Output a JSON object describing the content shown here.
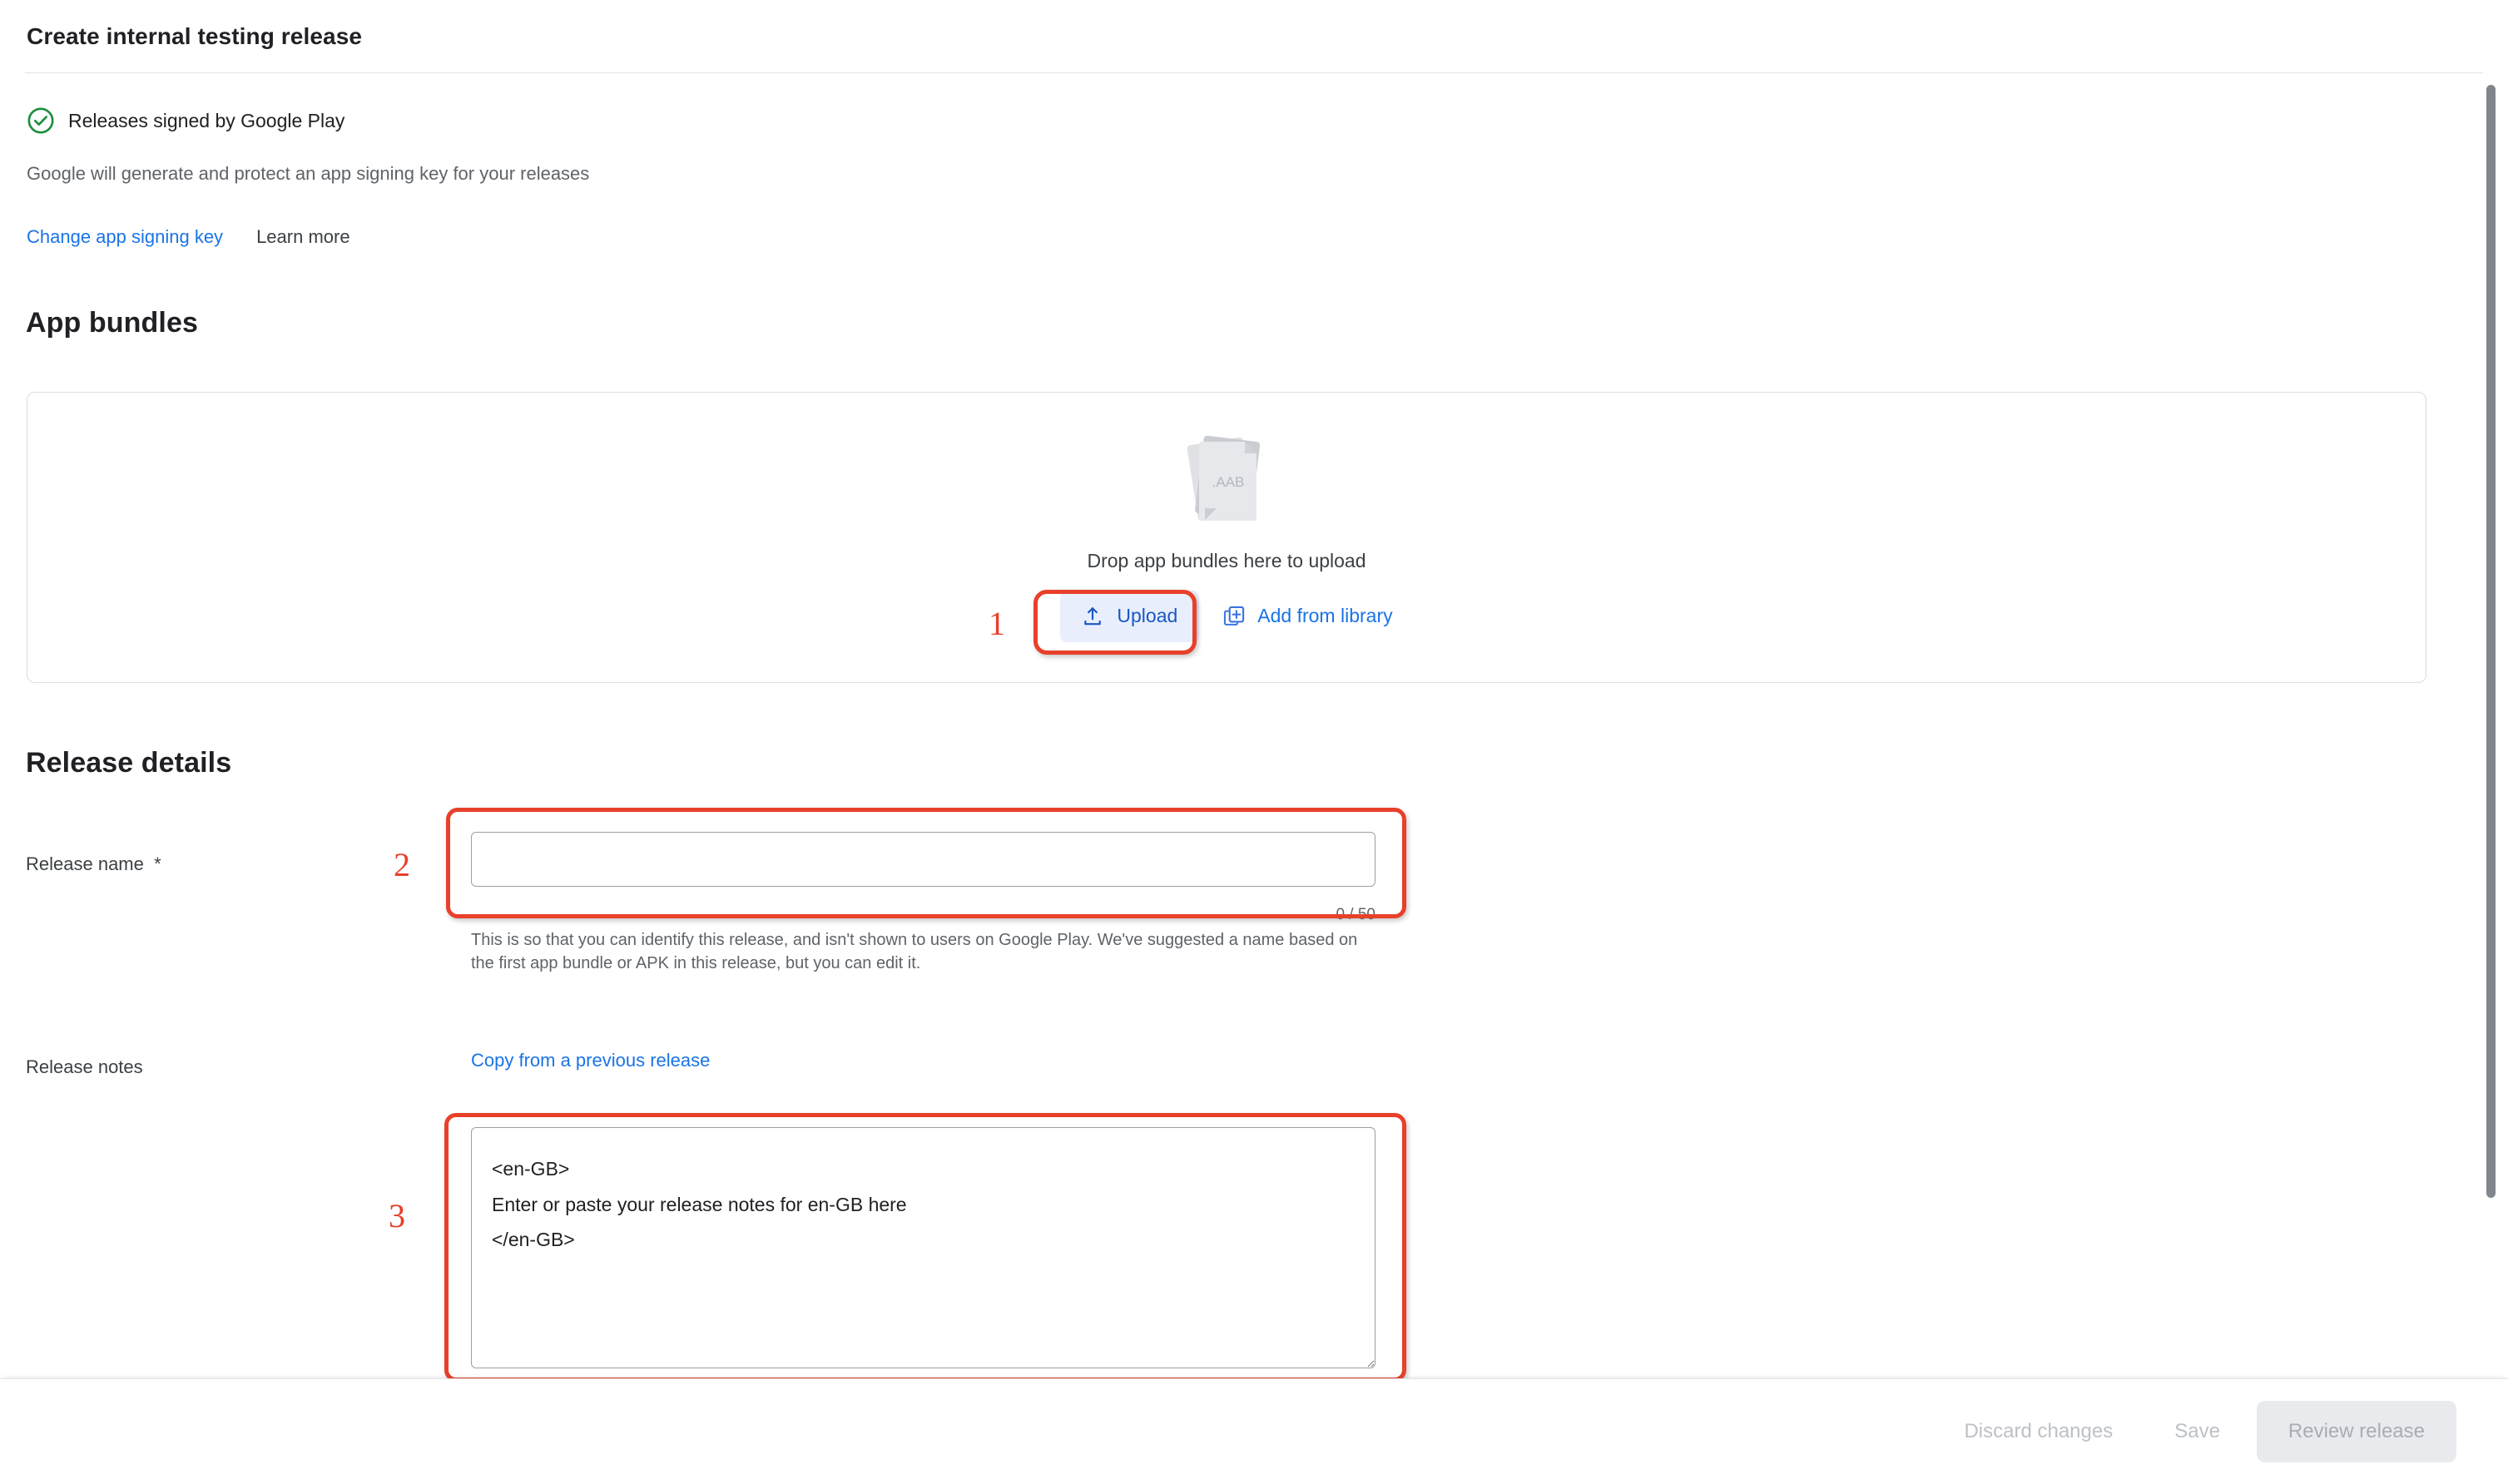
{
  "header": {
    "title": "Create internal testing release"
  },
  "signing": {
    "status_icon": "check-circle-icon",
    "status_text": "Releases signed by Google Play",
    "description": "Google will generate and protect an app signing key for your releases",
    "change_key_link": "Change app signing key",
    "learn_more_link": "Learn more",
    "status_color": "#1e8e3e"
  },
  "app_bundles": {
    "section_title": "App bundles",
    "file_icon_label": ".AAB",
    "dropzone_text": "Drop app bundles here to upload",
    "upload_button": {
      "label": "Upload",
      "icon": "upload-icon",
      "bg_color": "#e8eefc",
      "text_color": "#1a56c4"
    },
    "add_from_library": {
      "label": "Add from library",
      "icon": "library-add-icon",
      "color": "#1a73e8"
    }
  },
  "release_details": {
    "section_title": "Release details",
    "release_name": {
      "label": "Release name",
      "required_marker": "*",
      "value": "",
      "placeholder": "",
      "char_counter": "0 / 50",
      "helper_text": "This is so that you can identify this release, and isn't shown to users on Google Play. We've suggested a name based on the first app bundle or APK in this release, but you can edit it."
    },
    "release_notes": {
      "label": "Release notes",
      "copy_link": "Copy from a previous release",
      "value": "<en-GB>\nEnter or paste your release notes for en-GB here\n</en-GB>"
    }
  },
  "bottom_bar": {
    "discard_label": "Discard changes",
    "save_label": "Save",
    "review_label": "Review release",
    "disabled_color": "#bdc1c6"
  },
  "annotations": {
    "color": "#e8402a",
    "items": [
      {
        "number": "1",
        "target": "upload-button"
      },
      {
        "number": "2",
        "target": "release-name-input"
      },
      {
        "number": "3",
        "target": "release-notes-textarea"
      }
    ]
  }
}
